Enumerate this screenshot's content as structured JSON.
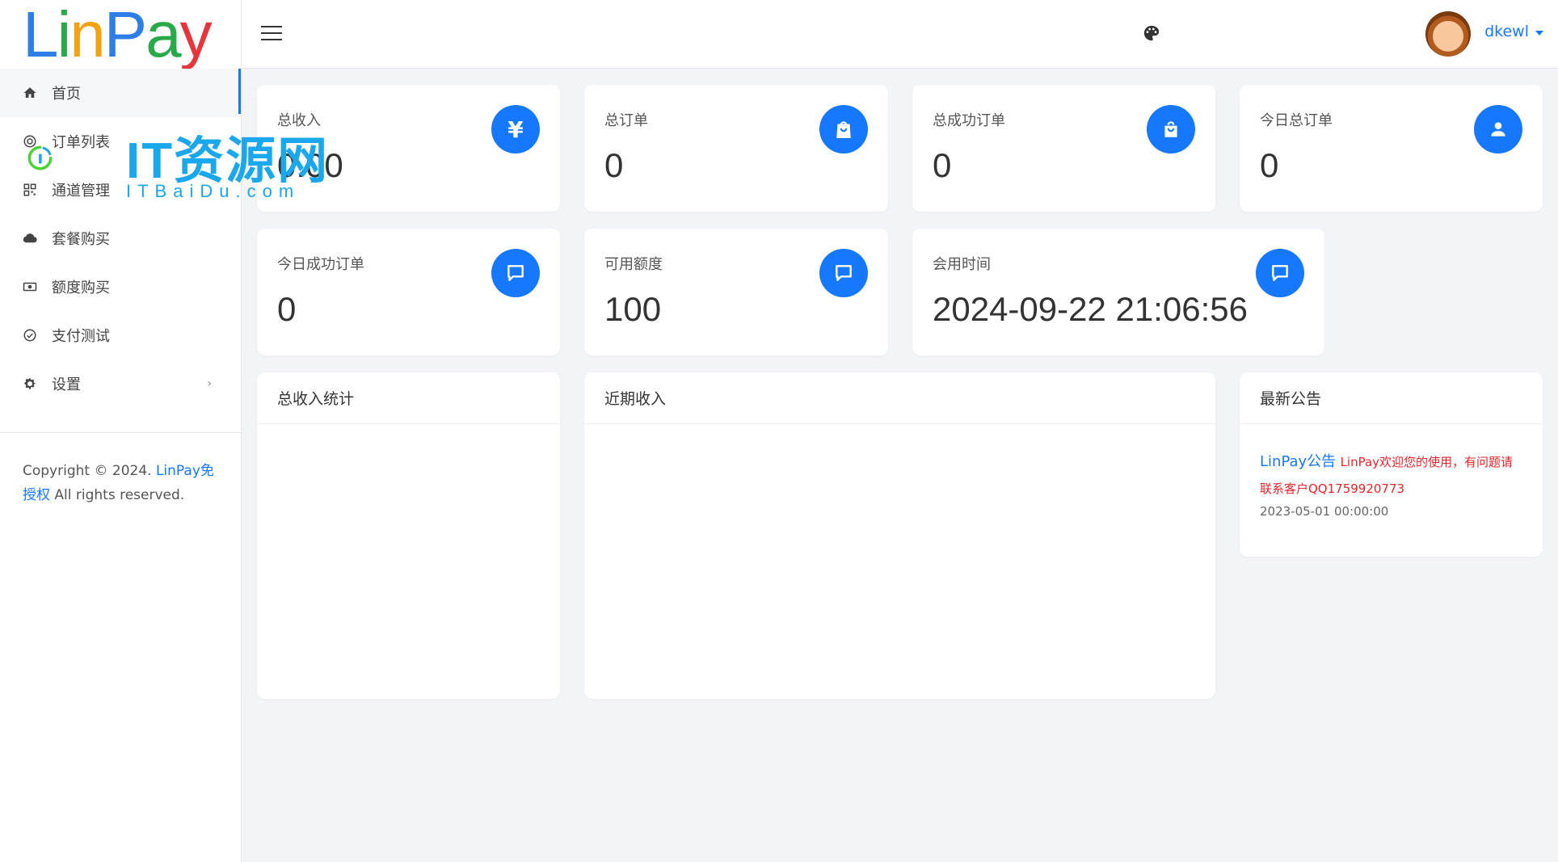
{
  "brand": {
    "logo_letters": [
      "L",
      "i",
      "n",
      "P",
      "a",
      "y"
    ]
  },
  "sidebar": {
    "items": [
      {
        "label": "首页",
        "icon": "home-icon"
      },
      {
        "label": "订单列表",
        "icon": "target-icon"
      },
      {
        "label": "通道管理",
        "icon": "qrcode-icon"
      },
      {
        "label": "套餐购买",
        "icon": "cloud-icon"
      },
      {
        "label": "额度购买",
        "icon": "money-icon"
      },
      {
        "label": "支付测试",
        "icon": "check-circle-icon"
      },
      {
        "label": "设置",
        "icon": "gear-icon",
        "chevron": "›"
      }
    ],
    "footer": {
      "copyright": "Copyright © 2024.",
      "link": "LinPay免授权",
      "rights": "All rights reserved."
    }
  },
  "header": {
    "username": "dkewl"
  },
  "stats": [
    {
      "label": "总收入",
      "value": "0.00",
      "icon": "yen-icon",
      "glyph": "¥"
    },
    {
      "label": "总订单",
      "value": "0",
      "icon": "shopping-bag-icon"
    },
    {
      "label": "总成功订单",
      "value": "0",
      "icon": "shopping-bag-icon"
    },
    {
      "label": "今日总订单",
      "value": "0",
      "icon": "user-icon"
    },
    {
      "label": "今日成功订单",
      "value": "0",
      "icon": "message-icon"
    },
    {
      "label": "可用额度",
      "value": "100",
      "icon": "message-icon"
    },
    {
      "label": "会用时间",
      "value": "2024-09-22 21:06:56",
      "icon": "message-icon"
    }
  ],
  "panels": {
    "total_income_stats": "总收入统计",
    "recent_income": "近期收入",
    "latest_notice": "最新公告"
  },
  "notice": {
    "title": "LinPay公告",
    "body": "LinPay欢迎您的使用，有问题请联系客户QQ1759920773",
    "date": "2023-05-01 00:00:00"
  },
  "watermark": {
    "title": "IT资源网",
    "subtitle": "ITBaiDu.com"
  },
  "colors": {
    "primary": "#1677ff",
    "notice_red": "#e5252a",
    "background": "#f3f4f8"
  }
}
